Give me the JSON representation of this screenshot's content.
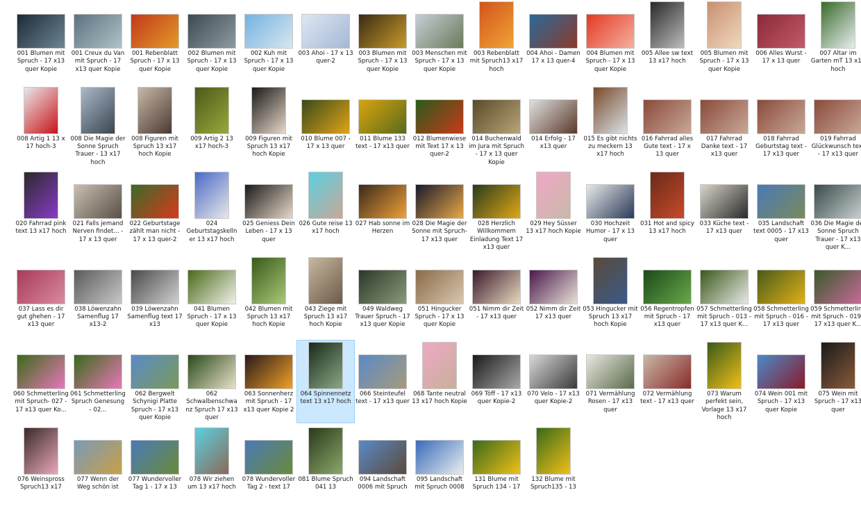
{
  "files": [
    {
      "name": "001 Blumen mit Spruch - 17 x13 quer Kopie",
      "orient": "land",
      "colors": [
        "#1c2a36",
        "#6e8594"
      ],
      "icon": "image-thumbnail-icon"
    },
    {
      "name": "001 Creux du Van mit Spruch - 17 x13 quer Kopie",
      "orient": "land",
      "colors": [
        "#5c7280",
        "#b0c2c8"
      ],
      "icon": "image-thumbnail-icon"
    },
    {
      "name": "001 Rebenblatt Spruch - 17 x 13 quer Kopie",
      "orient": "land",
      "colors": [
        "#c2391a",
        "#e49a2a"
      ],
      "icon": "image-thumbnail-icon"
    },
    {
      "name": "002 Blumen mit Spruch - 17 x 13 quer Kopie",
      "orient": "land",
      "colors": [
        "#3e4a52",
        "#8c9aa2"
      ],
      "icon": "image-thumbnail-icon"
    },
    {
      "name": "002 Kuh mit Spruch - 17 x 13 quer Kopie",
      "orient": "land",
      "colors": [
        "#74b2e2",
        "#d8e6f0"
      ],
      "icon": "image-thumbnail-icon"
    },
    {
      "name": "003 Ahoi - 17 x 13 quer-2",
      "orient": "land",
      "colors": [
        "#dfe6f2",
        "#a4b8d6"
      ],
      "icon": "image-thumbnail-icon"
    },
    {
      "name": "003 Blumen mit Spruch - 17 x 13 quer Kopie",
      "orient": "land",
      "colors": [
        "#3a2a12",
        "#c89a2c"
      ],
      "icon": "image-thumbnail-icon"
    },
    {
      "name": "003 Menschen mit Spruch - 17 x 13 quer Kopie",
      "orient": "land",
      "colors": [
        "#c6ced6",
        "#6a7a5a"
      ],
      "icon": "image-thumbnail-icon"
    },
    {
      "name": "003 Rebenblatt mit Spruch13 x17 hoch",
      "orient": "port",
      "colors": [
        "#d2541c",
        "#f0a436"
      ],
      "icon": "image-thumbnail-icon"
    },
    {
      "name": "004 Ahoi - Damen 17 x 13 quer-4",
      "orient": "land",
      "colors": [
        "#2a6a9a",
        "#8a3a2a"
      ],
      "icon": "image-thumbnail-icon"
    },
    {
      "name": "004 Blumen mit Spruch - 17 x 13 quer Kopie",
      "orient": "land",
      "colors": [
        "#e23a22",
        "#f6b0a0"
      ],
      "icon": "image-thumbnail-icon"
    },
    {
      "name": "005 Allee sw text 13 x17 hoch",
      "orient": "port",
      "colors": [
        "#2a2a2a",
        "#bcbcbc"
      ],
      "icon": "image-thumbnail-icon"
    },
    {
      "name": "005 Blumen mit Spruch - 17 x 13 quer Kopie",
      "orient": "port",
      "colors": [
        "#c89070",
        "#f0d8c0"
      ],
      "icon": "image-thumbnail-icon"
    },
    {
      "name": "006 Alles Wurst - 17 x 13 quer",
      "orient": "land",
      "colors": [
        "#8a2a3a",
        "#c25a6a"
      ],
      "icon": "image-thumbnail-icon"
    },
    {
      "name": "007 Altar im Garten mT 13 x17 hoch",
      "orient": "port",
      "colors": [
        "#3a6a2a",
        "#e8eef0"
      ],
      "icon": "image-thumbnail-icon"
    },
    {
      "name": "008 Artig 1 13 x 17 hoch-3",
      "orient": "port",
      "colors": [
        "#e8e8e8",
        "#c8141a"
      ],
      "icon": "image-thumbnail-icon"
    },
    {
      "name": "008 Die Magie der Sonne Spruch Trauer - 13 x17 hoch",
      "orient": "port",
      "colors": [
        "#aab8c8",
        "#3a4650"
      ],
      "icon": "image-thumbnail-icon"
    },
    {
      "name": "008 Figuren mit Spruch 13 x17 hoch Kopie",
      "orient": "port",
      "colors": [
        "#c8b8a8",
        "#4a3a32"
      ],
      "icon": "image-thumbnail-icon"
    },
    {
      "name": "009 Artig 2 13 x17 hoch-3",
      "orient": "port",
      "colors": [
        "#4a5a1a",
        "#9aa83a"
      ],
      "icon": "image-thumbnail-icon"
    },
    {
      "name": "009 Figuren mit Spruch 13 x17 hoch Kopie",
      "orient": "port",
      "colors": [
        "#1a1a1a",
        "#e8d8c8"
      ],
      "icon": "image-thumbnail-icon"
    },
    {
      "name": "010 Blume 007 - 17 x 13 quer",
      "orient": "land",
      "colors": [
        "#3a4a1a",
        "#e0a418"
      ],
      "icon": "image-thumbnail-icon"
    },
    {
      "name": "011 Blume 133 text - 17 x13 quer",
      "orient": "land",
      "colors": [
        "#d8a410",
        "#5a6a1a"
      ],
      "icon": "image-thumbnail-icon"
    },
    {
      "name": "012 Blumenwiese mit Text 17 x 13 quer-2",
      "orient": "land",
      "colors": [
        "#2a5a1a",
        "#c83a1a"
      ],
      "icon": "image-thumbnail-icon"
    },
    {
      "name": "014 Buchenwald im Jura mit Spruch - 17 x 13 quer Kopie",
      "orient": "land",
      "colors": [
        "#5a4a2a",
        "#b8a478"
      ],
      "icon": "image-thumbnail-icon"
    },
    {
      "name": "014 Erfolg - 17 x13 quer",
      "orient": "land",
      "colors": [
        "#e0e0e0",
        "#5a3a2a"
      ],
      "icon": "image-thumbnail-icon"
    },
    {
      "name": "015 Es gibt nichts zu meckern 13 x17 hoch",
      "orient": "port",
      "colors": [
        "#7a4a2a",
        "#d8e2e8"
      ],
      "icon": "image-thumbnail-icon"
    },
    {
      "name": "016 Fahrrad alles Gute text - 17 x 13 quer",
      "orient": "land",
      "colors": [
        "#8a4a3a",
        "#c8a898"
      ],
      "icon": "image-thumbnail-icon"
    },
    {
      "name": "017 Fahrrad Danke text - 17 x13 quer",
      "orient": "land",
      "colors": [
        "#8a4a3a",
        "#c8a898"
      ],
      "icon": "image-thumbnail-icon"
    },
    {
      "name": "018 Fahrrad Geburtstag text - 17 x13 quer",
      "orient": "land",
      "colors": [
        "#8a4a3a",
        "#c8a898"
      ],
      "icon": "image-thumbnail-icon"
    },
    {
      "name": "019 Fahrrad Glückwunsch text - 17 x13 quer",
      "orient": "land",
      "colors": [
        "#8a4a3a",
        "#c8a898"
      ],
      "icon": "image-thumbnail-icon"
    },
    {
      "name": "020 Fahrrad pink text 13 x17 hoch",
      "orient": "port",
      "colors": [
        "#2a2a2a",
        "#8a3ac8"
      ],
      "icon": "image-thumbnail-icon"
    },
    {
      "name": "021 Falls jemand Nerven findet... - 17 x 13 quer",
      "orient": "land",
      "colors": [
        "#c8c0b0",
        "#5a5048"
      ],
      "icon": "image-thumbnail-icon"
    },
    {
      "name": "022 Geburtstage zählt man nicht - 17 x 13 quer-2",
      "orient": "land",
      "colors": [
        "#3a6a2a",
        "#d83a1a"
      ],
      "icon": "image-thumbnail-icon"
    },
    {
      "name": "024 Geburtstagskelln er 13 x17 hoch",
      "orient": "port",
      "colors": [
        "#4a6ac8",
        "#e8e8e8"
      ],
      "icon": "image-thumbnail-icon"
    },
    {
      "name": "025 Geniess Dein Leben - 17 x 13 quer",
      "orient": "land",
      "colors": [
        "#1a1a1a",
        "#e8d8c8"
      ],
      "icon": "image-thumbnail-icon"
    },
    {
      "name": "026 Gute reise 13 x17 hoch",
      "orient": "port",
      "colors": [
        "#5ad0e0",
        "#c8a898"
      ],
      "icon": "image-thumbnail-icon"
    },
    {
      "name": "027 Hab sonne im Herzen",
      "orient": "land",
      "colors": [
        "#3a2a1a",
        "#f0a038"
      ],
      "icon": "image-thumbnail-icon"
    },
    {
      "name": "028 Die Magie der Sonne mit Spruch- 17 x13 quer",
      "orient": "land",
      "colors": [
        "#1a1a2a",
        "#e8a848"
      ],
      "icon": "image-thumbnail-icon"
    },
    {
      "name": "028 Herzlich Willkommem Einladung Text 17 x13 quer",
      "orient": "land",
      "colors": [
        "#2a3a1a",
        "#e0a818"
      ],
      "icon": "image-thumbnail-icon"
    },
    {
      "name": "029 Hey Süsser 13 x17 hoch Kopie",
      "orient": "port",
      "colors": [
        "#f0a8c8",
        "#c8b8a8"
      ],
      "icon": "image-thumbnail-icon"
    },
    {
      "name": "030 Hochzeit Humor - 17 x 13 quer",
      "orient": "land",
      "colors": [
        "#e8e8e8",
        "#2a3a5a"
      ],
      "icon": "image-thumbnail-icon"
    },
    {
      "name": "031 Hot and spicy 13 x17 hoch",
      "orient": "port",
      "colors": [
        "#6a2a1a",
        "#c84a2a"
      ],
      "icon": "image-thumbnail-icon"
    },
    {
      "name": "033 Küche text - 17 x13 quer",
      "orient": "land",
      "colors": [
        "#d8d4c8",
        "#2a2a2a"
      ],
      "icon": "image-thumbnail-icon"
    },
    {
      "name": "035 Landschaft text 0005 - 17 x13 quer",
      "orient": "land",
      "colors": [
        "#4a7ab8",
        "#7a8a5a"
      ],
      "icon": "image-thumbnail-icon"
    },
    {
      "name": "036 Die Magie der Sonne Spruch Trauer - 17 x13 quer K...",
      "orient": "land",
      "colors": [
        "#3a4a4a",
        "#c8d0d0"
      ],
      "icon": "image-thumbnail-icon"
    },
    {
      "name": "037 Lass es dir gut ghehen - 17 x13 quer",
      "orient": "land",
      "colors": [
        "#a83a5a",
        "#d88aa0"
      ],
      "icon": "image-thumbnail-icon"
    },
    {
      "name": "038 Löwenzahn Samenflug 17 x13-2",
      "orient": "land",
      "colors": [
        "#5a5a5a",
        "#c8c8c8"
      ],
      "icon": "image-thumbnail-icon"
    },
    {
      "name": "039 Löwenzahn Samenflug text 17 x13",
      "orient": "land",
      "colors": [
        "#4a4a4a",
        "#d0d0d0"
      ],
      "icon": "image-thumbnail-icon"
    },
    {
      "name": "041 Blumen Spruch - 17 x 13 quer Kopie",
      "orient": "land",
      "colors": [
        "#4a6a1a",
        "#f0f0e8"
      ],
      "icon": "image-thumbnail-icon"
    },
    {
      "name": "042 Blumen mit Spruch 13 x17 hoch Kopie",
      "orient": "port",
      "colors": [
        "#3a5a1a",
        "#a8c878"
      ],
      "icon": "image-thumbnail-icon"
    },
    {
      "name": "043 Ziege mit Spruch 13 x17 hoch Kopie",
      "orient": "port",
      "colors": [
        "#c8b8a0",
        "#6a5a48"
      ],
      "icon": "image-thumbnail-icon"
    },
    {
      "name": "049 Waldweg Trauer Spruch - 17 x13 quer Kopie",
      "orient": "land",
      "colors": [
        "#2a3a2a",
        "#8a9a7a"
      ],
      "icon": "image-thumbnail-icon"
    },
    {
      "name": "051 Hingucker Spruch - 17 x 13 quer Kopie",
      "orient": "land",
      "colors": [
        "#8a6a4a",
        "#d8c8b0"
      ],
      "icon": "image-thumbnail-icon"
    },
    {
      "name": "051 Nimm dir Zeit - 17 x13 quer",
      "orient": "land",
      "colors": [
        "#3a1a2a",
        "#e8d8c0"
      ],
      "icon": "image-thumbnail-icon"
    },
    {
      "name": "052 Nimm dir Zeit 17 x13 quer",
      "orient": "land",
      "colors": [
        "#4a1a4a",
        "#e8e0d8"
      ],
      "icon": "image-thumbnail-icon"
    },
    {
      "name": "053 Hingucker mit Spruch 13 x17 hoch Kopie",
      "orient": "port",
      "colors": [
        "#5a4a3a",
        "#3a5a8a"
      ],
      "icon": "image-thumbnail-icon"
    },
    {
      "name": "056 Regentropfen mit Spruch - 17 x13 quer",
      "orient": "land",
      "colors": [
        "#1a4a1a",
        "#6aa84a"
      ],
      "icon": "image-thumbnail-icon"
    },
    {
      "name": "057 Schmetterling mit Spruch - 013 - 17 x13 quer K...",
      "orient": "land",
      "colors": [
        "#3a5a1a",
        "#e8e8e8"
      ],
      "icon": "image-thumbnail-icon"
    },
    {
      "name": "058 Schmetterling mit Spruch - 016 - 17 x13 quer",
      "orient": "land",
      "colors": [
        "#4a5a1a",
        "#e0b018"
      ],
      "icon": "image-thumbnail-icon"
    },
    {
      "name": "059 Schmetterling mit Spruch - 019 - 17 x13 quer K...",
      "orient": "land",
      "colors": [
        "#3a5a2a",
        "#c86a9a"
      ],
      "icon": "image-thumbnail-icon"
    },
    {
      "name": "060 Schmetterling mit Spruch- 027 - 17 x13 quer Ko...",
      "orient": "land",
      "colors": [
        "#3a6a1a",
        "#e878b8"
      ],
      "icon": "image-thumbnail-icon"
    },
    {
      "name": "061 Schmetterling Spruch Genesung - 02...",
      "orient": "land",
      "colors": [
        "#3a6a1a",
        "#e878b8"
      ],
      "icon": "image-thumbnail-icon"
    },
    {
      "name": "062 Bergwelt Schynigi Platte Spruch - 17 x13 quer Kopie",
      "orient": "land",
      "colors": [
        "#5a8ac8",
        "#7a9a5a"
      ],
      "icon": "image-thumbnail-icon"
    },
    {
      "name": "062 Schwalbenschwa nz Spruch 17 x13 quer",
      "orient": "land",
      "colors": [
        "#2a4a1a",
        "#e8e0c8"
      ],
      "icon": "image-thumbnail-icon"
    },
    {
      "name": "063 Sonnenherz mit Spruch - 17 x13 quer Kopie 2",
      "orient": "land",
      "colors": [
        "#2a1a1a",
        "#f0a028"
      ],
      "icon": "image-thumbnail-icon"
    },
    {
      "name": "064 Spinnennetz text 13 x17 hoch",
      "orient": "port",
      "colors": [
        "#1a2a1a",
        "#8aa888"
      ],
      "icon": "image-thumbnail-icon",
      "selected": true
    },
    {
      "name": "066 Steinteufel text - 17 x13 quer",
      "orient": "land",
      "colors": [
        "#5a8ac8",
        "#a89a7a"
      ],
      "icon": "image-thumbnail-icon"
    },
    {
      "name": "068 Tante neutral 13 x17 hoch Kopie",
      "orient": "port",
      "colors": [
        "#f0a8c8",
        "#c8b098"
      ],
      "icon": "image-thumbnail-icon"
    },
    {
      "name": "069 Töff - 17 x13 quer Kopie-2",
      "orient": "land",
      "colors": [
        "#1a1a1a",
        "#a8a8a8"
      ],
      "icon": "image-thumbnail-icon"
    },
    {
      "name": "070 Velo - 17 x13 quer Kopie-2",
      "orient": "land",
      "colors": [
        "#d8d8d8",
        "#3a3a3a"
      ],
      "icon": "image-thumbnail-icon"
    },
    {
      "name": "071 Vermählung Rosen - 17 x13 quer",
      "orient": "land",
      "colors": [
        "#e8e8e0",
        "#5a6a4a"
      ],
      "icon": "image-thumbnail-icon"
    },
    {
      "name": "072 Vermählung text - 17 x13 quer",
      "orient": "land",
      "colors": [
        "#c8b8a8",
        "#8a2a2a"
      ],
      "icon": "image-thumbnail-icon"
    },
    {
      "name": "073 Warum perfekt sein, Vorlage 13 x17 hoch",
      "orient": "port",
      "colors": [
        "#3a5a1a",
        "#f0c018"
      ],
      "icon": "image-thumbnail-icon"
    },
    {
      "name": "074 Wein 001 mit Spruch - 17 x13 quer Kopie",
      "orient": "land",
      "colors": [
        "#4a8ac8",
        "#8a1a2a"
      ],
      "icon": "image-thumbnail-icon"
    },
    {
      "name": "075 Wein mit Spruch - 17 x13 quer",
      "orient": "port",
      "colors": [
        "#1a1a1a",
        "#8a5a3a"
      ],
      "icon": "image-thumbnail-icon"
    },
    {
      "name": "076 Weinspross Spruch13 x17",
      "orient": "port",
      "colors": [
        "#3a2a2a",
        "#e8a8b8"
      ],
      "icon": "image-thumbnail-icon"
    },
    {
      "name": "077 Wenn der Weg schön ist",
      "orient": "land",
      "colors": [
        "#7a9ab8",
        "#c8a048"
      ],
      "icon": "image-thumbnail-icon"
    },
    {
      "name": "077 Wundervoller Tag 1 - 17 x 13",
      "orient": "land",
      "colors": [
        "#4a7ab8",
        "#6a8a3a"
      ],
      "icon": "image-thumbnail-icon"
    },
    {
      "name": "078 Wir ziehen um 13 x17 hoch",
      "orient": "port",
      "colors": [
        "#5ad0e0",
        "#8a6a5a"
      ],
      "icon": "image-thumbnail-icon"
    },
    {
      "name": "078 Wundervoller Tag 2 - text 17",
      "orient": "land",
      "colors": [
        "#4a7ab8",
        "#6a8a3a"
      ],
      "icon": "image-thumbnail-icon"
    },
    {
      "name": "081 Blume Spruch 041 13",
      "orient": "port",
      "colors": [
        "#2a3a1a",
        "#8aa86a"
      ],
      "icon": "image-thumbnail-icon"
    },
    {
      "name": "094 Landschaft 0006 mit Spruch",
      "orient": "land",
      "colors": [
        "#5a8ac8",
        "#5a4a3a"
      ],
      "icon": "image-thumbnail-icon"
    },
    {
      "name": "095 Landschaft mit Spruch 0008",
      "orient": "land",
      "colors": [
        "#3a6ab8",
        "#e8eef0"
      ],
      "icon": "image-thumbnail-icon"
    },
    {
      "name": "131 Blume mit Spruch 134 - 17",
      "orient": "land",
      "colors": [
        "#3a6a1a",
        "#f0c018"
      ],
      "icon": "image-thumbnail-icon"
    },
    {
      "name": "132 Blume mit Spruch135 - 13",
      "orient": "port",
      "colors": [
        "#3a6a1a",
        "#f0c018"
      ],
      "icon": "image-thumbnail-icon"
    }
  ]
}
